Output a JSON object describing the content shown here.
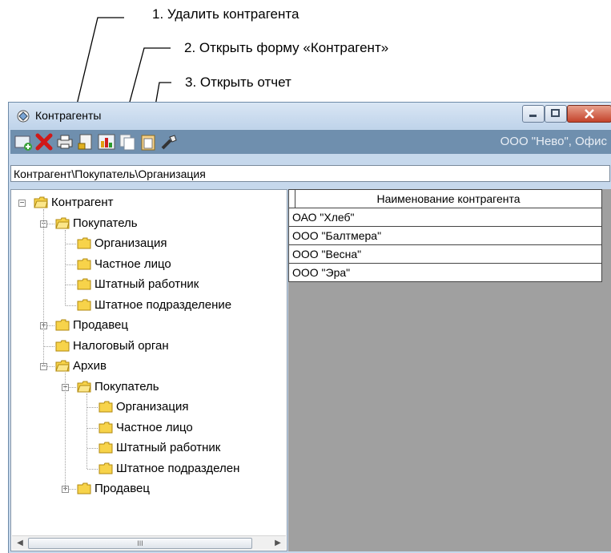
{
  "annotations": [
    "1. Удалить контрагента",
    "2. Открыть форму «Контрагент»",
    "3. Открыть отчет"
  ],
  "window": {
    "title": "Контрагенты",
    "company": "ООО \"Нево\", Офис"
  },
  "toolbar": {
    "buttons": [
      "add-icon",
      "delete-icon",
      "print-icon",
      "open-form-icon",
      "report-icon",
      "copy-icon",
      "paste-icon",
      "search-icon"
    ]
  },
  "path": "Контрагент\\Покупатель\\Организация",
  "tree": [
    {
      "label": "Контрагент",
      "level": 0,
      "expanded": true
    },
    {
      "label": "Покупатель",
      "level": 1,
      "expanded": true
    },
    {
      "label": "Организация",
      "level": 2
    },
    {
      "label": "Частное лицо",
      "level": 2
    },
    {
      "label": "Штатный работник",
      "level": 2
    },
    {
      "label": "Штатное подразделение",
      "level": 2
    },
    {
      "label": "Продавец",
      "level": 1,
      "expanded": false
    },
    {
      "label": "Налоговый орган",
      "level": 1
    },
    {
      "label": "Архив",
      "level": 1,
      "expanded": true
    },
    {
      "label": "Покупатель",
      "level": 2,
      "expanded": true
    },
    {
      "label": "Организация",
      "level": 3
    },
    {
      "label": "Частное лицо",
      "level": 3
    },
    {
      "label": "Штатный работник",
      "level": 3
    },
    {
      "label": "Штатное подразделен",
      "level": 3
    },
    {
      "label": "Продавец",
      "level": 2,
      "expanded": false
    }
  ],
  "grid": {
    "header": "Наименование контрагента",
    "rows": [
      "ОАО \"Хлеб\"",
      "ООО \"Балтмера\"",
      "ООО \"Весна\"",
      "ООО \"Эра\""
    ]
  },
  "scrollbar": {
    "thumb_grip": "III"
  }
}
